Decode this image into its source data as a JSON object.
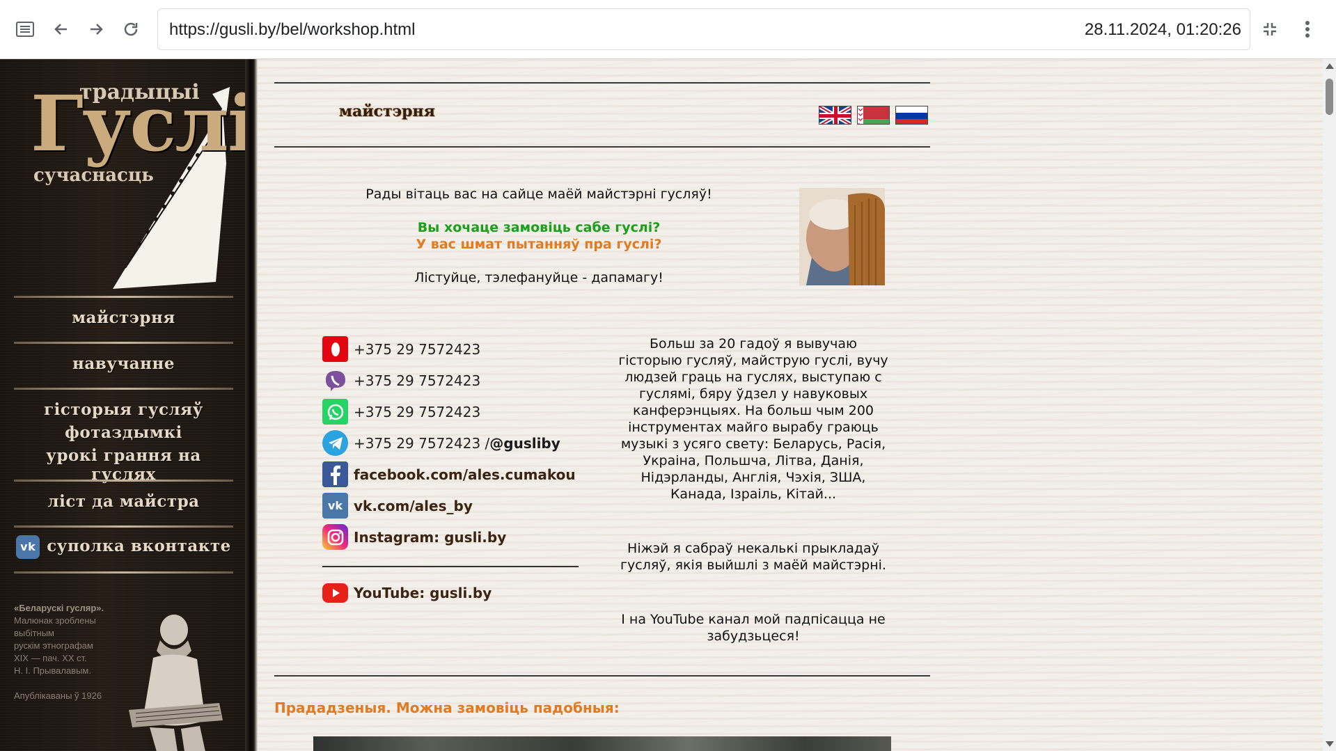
{
  "browser": {
    "url": "https://gusli.by/bel/workshop.html",
    "datetime": "28.11.2024, 01:20:26"
  },
  "logo": {
    "top": "традыцыі",
    "big": "Гуслі",
    "bottom": "сучаснасць"
  },
  "sidebar": {
    "items": [
      {
        "label": "майстэрня"
      },
      {
        "label": "навучанне"
      },
      {
        "label": "гісторыя гусляў"
      },
      {
        "label": "фотаздымкі"
      },
      {
        "label": "урокі грання на гуслях"
      },
      {
        "label": "ліст да майстра"
      },
      {
        "label": "суполка вконтакте"
      }
    ],
    "caption": {
      "title": "«Беларускі гусляр».",
      "lines": [
        "Малюнак зроблены",
        "выбітным",
        "рускім этнографам",
        "XIX — пач. XX ст.",
        "Н. І. Прывалавым.",
        "",
        "Апублікаваны ў 1926"
      ]
    }
  },
  "header": {
    "title": "майстэрня"
  },
  "welcome": {
    "line1": "Рады вітаць вас на сайце маёй майстэрні гусляў!",
    "line2": "Вы хочаце замовіць сабе гуслі?",
    "line3": "У вас шмат пытанняў пра гуслі?",
    "line4": "Лістуйце, тэлефануйце - дапамагу!"
  },
  "contacts": {
    "mts": "+375 29 7572423",
    "viber": "+375 29 7572423",
    "whatsapp": "+375 29 7572423",
    "telegram": "+375 29 7572423 / ",
    "telegram_handle": "@gusliby",
    "facebook": "facebook.com/ales.cumakou",
    "vk": "vk.com/ales_by",
    "instagram": "Instagram: gusli.by",
    "youtube": "YouTube: gusli.by"
  },
  "about": {
    "p1": "Больш за 20 гадоў я вывучаю гісторыю гусляў, майструю гуслі, вучу людзей граць на гуслях, выступаю с гуслямі, бяру ўдзел у навуковых канферэнцыях. На больш чым 200 інструментах майго вырабу граюць музыкі з усяго свету: Беларусь, Расія, Украіна, Польшча, Літва, Данія, Нідэрланды, Англія, Чэхія, ЗША, Канада, Ізраіль, Кітай...",
    "p2": "Ніжэй я сабраў некалькі прыкладаў гусляў, якія выйшлі з маёй майстэрні.",
    "p3": "І на YouTube канал мой падпісацца не забудзьцеся!"
  },
  "section": {
    "title": "Прададзеныя. Можна замовіць падобныя:"
  },
  "colors": {
    "accent_orange": "#e07b22",
    "accent_green": "#1aa01a",
    "sidebar_bg": "#1f1812"
  }
}
